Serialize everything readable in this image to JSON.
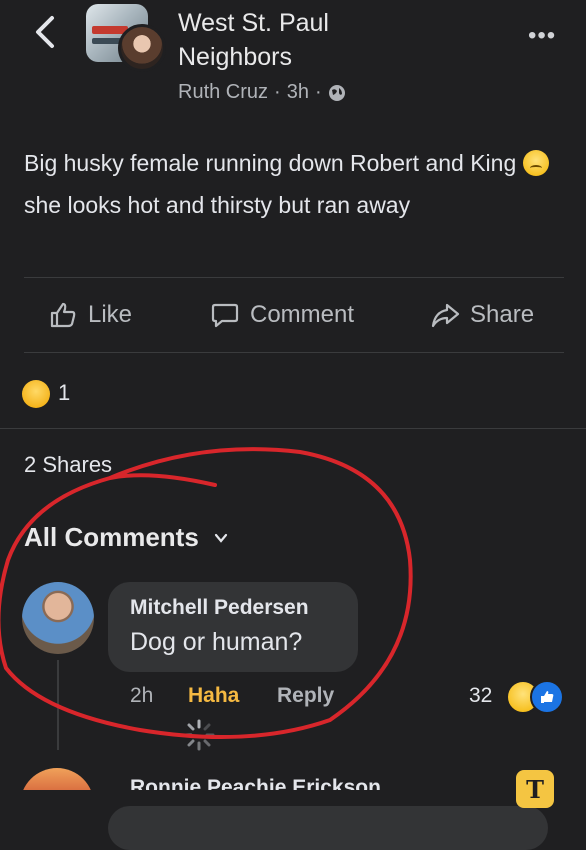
{
  "header": {
    "group_name": "West St. Paul\nNeighbors",
    "group_name_line1": "West St. Paul",
    "group_name_line2": "Neighbors",
    "poster": "Ruth Cruz",
    "time": "3h",
    "separator": "·",
    "more_label": "•••"
  },
  "post": {
    "text_part1": "Big husky female running down Robert and King ",
    "text_part2": "she looks hot and thirsty but ran away"
  },
  "actions": [
    {
      "label": "Like"
    },
    {
      "label": "Comment"
    },
    {
      "label": "Share"
    }
  ],
  "reactions": {
    "count": "1"
  },
  "shares_label": "2 Shares",
  "comments": {
    "header": "All Comments",
    "items": [
      {
        "author": "Mitchell Pedersen",
        "text": "Dog or human?",
        "time": "2h",
        "haha_label": "Haha",
        "reply_label": "Reply",
        "reaction_count": "32"
      }
    ],
    "next_author": "Ronnie Peachie Erickson"
  },
  "text_tool": {
    "label": "T"
  },
  "colors": {
    "background": "#1f1f21",
    "haha": "#f5b942",
    "annotation": "#d8262b",
    "like_blue": "#1b74e4"
  },
  "icons": [
    "back-arrow-icon",
    "globe-icon",
    "more-icon",
    "like-icon",
    "comment-icon",
    "share-icon",
    "sad-emoji-icon",
    "chevron-down-icon",
    "haha-reaction-icon",
    "like-reaction-icon",
    "loading-spinner-icon",
    "text-tool-icon"
  ]
}
